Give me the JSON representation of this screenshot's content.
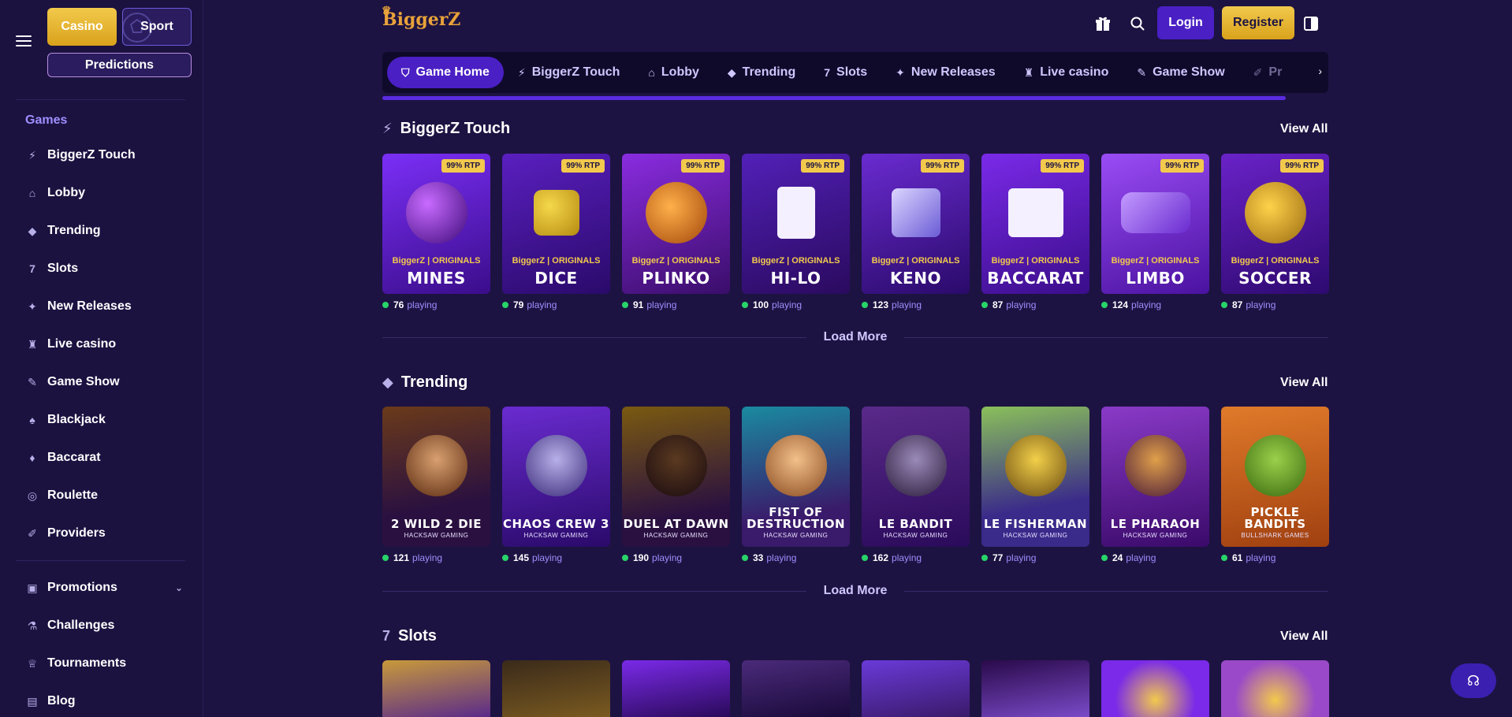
{
  "sidebar": {
    "casino_label": "Casino",
    "sport_label": "Sport",
    "predictions_label": "Predictions",
    "games_heading": "Games",
    "items": [
      {
        "label": "BiggerZ Touch",
        "icon": "lightning-icon"
      },
      {
        "label": "Lobby",
        "icon": "home-icon"
      },
      {
        "label": "Trending",
        "icon": "flame-icon"
      },
      {
        "label": "Slots",
        "icon": "slots-icon"
      },
      {
        "label": "New Releases",
        "icon": "sparkle-icon"
      },
      {
        "label": "Live casino",
        "icon": "live-casino-icon"
      },
      {
        "label": "Game Show",
        "icon": "microphone-icon"
      },
      {
        "label": "Blackjack",
        "icon": "cards-icon"
      },
      {
        "label": "Baccarat",
        "icon": "baccarat-icon"
      },
      {
        "label": "Roulette",
        "icon": "roulette-icon"
      },
      {
        "label": "Providers",
        "icon": "providers-icon"
      }
    ],
    "secondary_items": [
      {
        "label": "Promotions",
        "icon": "gift-icon"
      },
      {
        "label": "Challenges",
        "icon": "flask-icon"
      },
      {
        "label": "Tournaments",
        "icon": "trophy-icon"
      },
      {
        "label": "Blog",
        "icon": "blog-icon"
      }
    ]
  },
  "header": {
    "logo": "BiggerZ",
    "login_label": "Login",
    "register_label": "Register"
  },
  "catnav": {
    "tabs": [
      {
        "label": "Game Home",
        "active": true
      },
      {
        "label": "BiggerZ Touch"
      },
      {
        "label": "Lobby"
      },
      {
        "label": "Trending"
      },
      {
        "label": "Slots"
      },
      {
        "label": "New Releases"
      },
      {
        "label": "Live casino"
      },
      {
        "label": "Game Show"
      },
      {
        "label": "Pr"
      }
    ]
  },
  "sections": {
    "touch": {
      "title": "BiggerZ Touch",
      "view_all": "View All",
      "load_more": "Load More",
      "rtp": "99% RTP",
      "originals": "BiggerZ | ORIGINALS",
      "playing_label": "playing",
      "games": [
        {
          "name": "MINES",
          "playing": "76"
        },
        {
          "name": "DICE",
          "playing": "79"
        },
        {
          "name": "PLINKO",
          "playing": "91"
        },
        {
          "name": "HI-LO",
          "playing": "100"
        },
        {
          "name": "KENO",
          "playing": "123"
        },
        {
          "name": "BACCARAT",
          "playing": "87"
        },
        {
          "name": "LIMBO",
          "playing": "124"
        },
        {
          "name": "SOCCER",
          "playing": "87"
        }
      ]
    },
    "trending": {
      "title": "Trending",
      "view_all": "View All",
      "load_more": "Load More",
      "playing_label": "playing",
      "games": [
        {
          "name": "2 WILD 2 DIE",
          "provider": "HACKSAW GAMING",
          "playing": "121"
        },
        {
          "name": "CHAOS CREW 3",
          "provider": "HACKSAW GAMING",
          "playing": "145"
        },
        {
          "name": "DUEL AT DAWN",
          "provider": "HACKSAW GAMING",
          "playing": "190"
        },
        {
          "name": "FIST OF DESTRUCTION",
          "provider": "HACKSAW GAMING",
          "playing": "33"
        },
        {
          "name": "LE BANDIT",
          "provider": "HACKSAW GAMING",
          "playing": "162"
        },
        {
          "name": "LE FISHERMAN",
          "provider": "HACKSAW GAMING",
          "playing": "77"
        },
        {
          "name": "LE PHARAOH",
          "provider": "HACKSAW GAMING",
          "playing": "24"
        },
        {
          "name": "PICKLE BANDITS",
          "provider": "BULLSHARK GAMES",
          "playing": "61"
        }
      ]
    },
    "slots": {
      "title": "Slots",
      "view_all": "View All"
    }
  },
  "colors": {
    "background": "#1d1342",
    "accent_purple": "#4a1fc4",
    "accent_gold": "#f2c94c",
    "online_green": "#28d469"
  }
}
